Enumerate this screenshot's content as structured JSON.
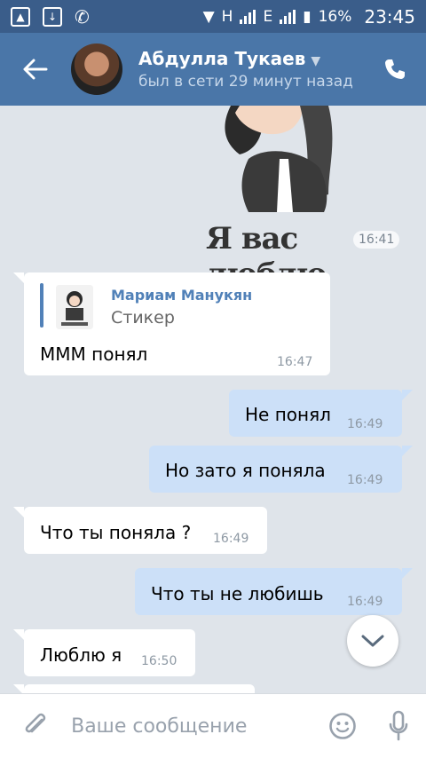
{
  "status_bar": {
    "network_h": "H",
    "network_e": "E",
    "battery": "16%",
    "time": "23:45"
  },
  "header": {
    "name": "Абдулла Тукаев",
    "status": "был в сети 29 минут назад"
  },
  "sticker_message": {
    "text": "Я вас люблю",
    "time": "16:41"
  },
  "messages": [
    {
      "type": "reply",
      "reply_author": "Мариам Манукян",
      "reply_preview": "Стикер",
      "text": "МММ понял",
      "time": "16:47"
    },
    {
      "type": "out",
      "text": "Не понял",
      "time": "16:49"
    },
    {
      "type": "out",
      "text": "Но зато я поняла",
      "time": "16:49"
    },
    {
      "type": "in",
      "text": "Что ты поняла ?",
      "time": "16:49"
    },
    {
      "type": "out",
      "text": "Что ты не любишь",
      "time": "16:49"
    },
    {
      "type": "in",
      "text": "Люблю я",
      "time": "16:50"
    }
  ],
  "composer": {
    "placeholder": "Ваше сообщение"
  },
  "icons": {
    "back": "back-arrow-icon",
    "call": "phone-icon",
    "attach": "paperclip-icon",
    "emoji": "smiley-icon",
    "voice": "microphone-icon",
    "scroll": "chevron-down-icon"
  },
  "colors": {
    "header": "#4a76a8",
    "status_bar": "#3a5d8a",
    "chat_bg": "#dfe4ea",
    "outgoing": "#cce0f8",
    "incoming": "#ffffff",
    "link": "#5181b8"
  }
}
